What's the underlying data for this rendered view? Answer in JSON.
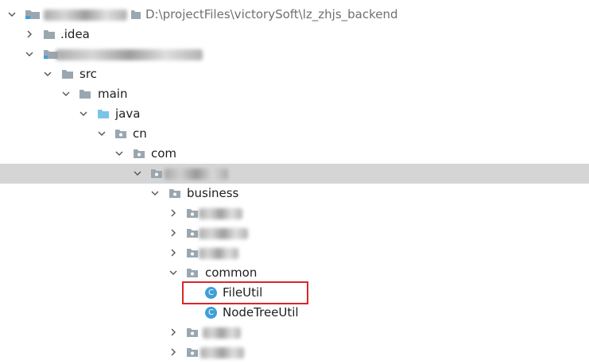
{
  "tree": {
    "root": {
      "path": "D:\\projectFiles\\victorySoft\\lz_zhjs_backend"
    },
    "idea": {
      "label": ".idea"
    },
    "src": {
      "label": "src"
    },
    "main": {
      "label": "main"
    },
    "java": {
      "label": "java"
    },
    "cn": {
      "label": "cn"
    },
    "com": {
      "label": "com"
    },
    "business": {
      "label": "business"
    },
    "common": {
      "label": "common"
    },
    "file_util": {
      "label": "FileUtil",
      "kind": "C"
    },
    "node_tree_util": {
      "label": "NodeTreeUtil",
      "kind": "C"
    }
  },
  "icons": {
    "folder_color": "#9aa7b0",
    "source_folder_color": "#79c5e8",
    "class_color": "#3f9fd8",
    "selection_color": "#d5d5d5",
    "highlight_border": "#d9262b"
  }
}
